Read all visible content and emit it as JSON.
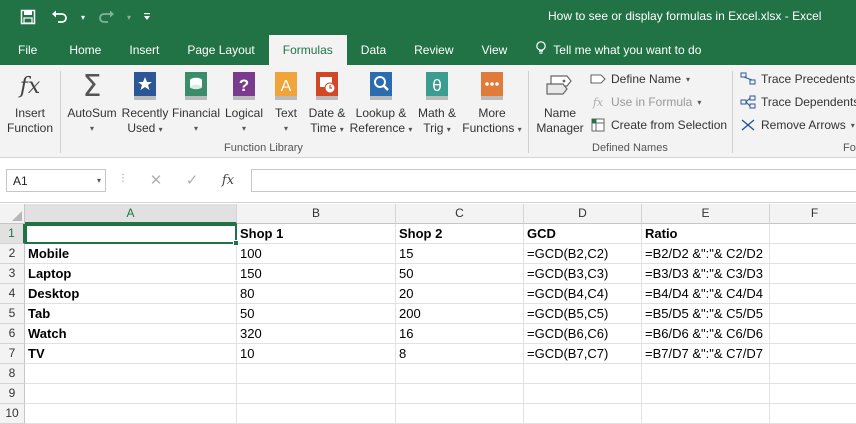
{
  "title": "How to see or display formulas in Excel.xlsx  -  Excel",
  "qat": {
    "save_icon": "save-icon",
    "undo_icon": "undo-icon",
    "redo_icon": "redo-icon",
    "customize_icon": "customize-qat-icon"
  },
  "tabs": [
    {
      "label": "File"
    },
    {
      "label": "Home"
    },
    {
      "label": "Insert"
    },
    {
      "label": "Page Layout"
    },
    {
      "label": "Formulas"
    },
    {
      "label": "Data"
    },
    {
      "label": "Review"
    },
    {
      "label": "View"
    }
  ],
  "active_tab": "Formulas",
  "tell_me": "Tell me what you want to do",
  "ribbon": {
    "insert_function": {
      "line1": "Insert",
      "line2": "Function"
    },
    "autosum": {
      "line1": "AutoSum"
    },
    "recently_used": {
      "line1": "Recently",
      "line2": "Used"
    },
    "financial": {
      "line1": "Financial"
    },
    "logical": {
      "line1": "Logical"
    },
    "text": {
      "line1": "Text"
    },
    "date_time": {
      "line1": "Date &",
      "line2": "Time"
    },
    "lookup": {
      "line1": "Lookup &",
      "line2": "Reference"
    },
    "math": {
      "line1": "Math &",
      "line2": "Trig"
    },
    "more": {
      "line1": "More",
      "line2": "Functions"
    },
    "function_library_label": "Function Library",
    "name_manager": {
      "line1": "Name",
      "line2": "Manager"
    },
    "define_name": "Define Name",
    "use_in_formula": "Use in Formula",
    "create_from_selection": "Create from Selection",
    "defined_names_label": "Defined Names",
    "trace_precedents": "Trace Precedents",
    "trace_dependents": "Trace Dependents",
    "remove_arrows": "Remove Arrows",
    "formula_auditing_label_partial": "Fo"
  },
  "formula_bar": {
    "name_box": "A1",
    "fx": "fx",
    "value": ""
  },
  "colors": {
    "brand": "#217346",
    "ribbon_bg": "#f3f3f3",
    "header_bg": "#f3f3f3"
  },
  "sheet": {
    "columns": [
      "A",
      "B",
      "C",
      "D",
      "E",
      "F"
    ],
    "row_numbers": [
      "1",
      "2",
      "3",
      "4",
      "5",
      "6",
      "7",
      "8",
      "9",
      "10"
    ],
    "active_cell": "A1",
    "rows": [
      [
        "",
        "Shop 1",
        "Shop 2",
        "GCD",
        "Ratio",
        ""
      ],
      [
        "Mobile",
        "100",
        "15",
        "=GCD(B2,C2)",
        "=B2/D2 &\":\"& C2/D2",
        ""
      ],
      [
        "Laptop",
        "150",
        "50",
        "=GCD(B3,C3)",
        "=B3/D3 &\":\"& C3/D3",
        ""
      ],
      [
        "Desktop",
        "80",
        "20",
        "=GCD(B4,C4)",
        "=B4/D4 &\":\"& C4/D4",
        ""
      ],
      [
        "Tab",
        "50",
        "200",
        "=GCD(B5,C5)",
        "=B5/D5 &\":\"& C5/D5",
        ""
      ],
      [
        "Watch",
        "320",
        "16",
        "=GCD(B6,C6)",
        "=B6/D6 &\":\"& C6/D6",
        ""
      ],
      [
        "TV",
        "10",
        "8",
        "=GCD(B7,C7)",
        "=B7/D7 &\":\"& C7/D7",
        ""
      ],
      [
        "",
        "",
        "",
        "",
        "",
        ""
      ],
      [
        "",
        "",
        "",
        "",
        "",
        ""
      ],
      [
        "",
        "",
        "",
        "",
        "",
        ""
      ]
    ]
  }
}
